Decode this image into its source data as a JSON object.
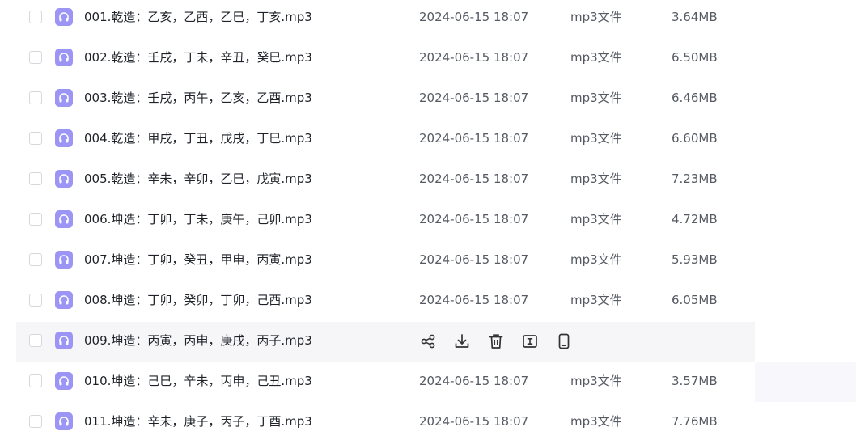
{
  "icons": {
    "file": "audio-headphones-icon",
    "share": "share-icon",
    "download": "download-icon",
    "delete": "trash-icon",
    "rename": "rename-icon",
    "phone": "phone-icon"
  },
  "colors": {
    "file_icon_bg": "#9c95f5",
    "hover_row_bg": "#f6f6f9",
    "meta_text": "#555a63"
  },
  "files": [
    {
      "name": "001.乾造：乙亥，乙酉，乙巳，丁亥.mp3",
      "date": "2024-06-15 18:07",
      "type": "mp3文件",
      "size": "3.64MB"
    },
    {
      "name": "002.乾造：壬戌，丁未，辛丑，癸巳.mp3",
      "date": "2024-06-15 18:07",
      "type": "mp3文件",
      "size": "6.50MB"
    },
    {
      "name": "003.乾造：壬戌，丙午，乙亥，乙酉.mp3",
      "date": "2024-06-15 18:07",
      "type": "mp3文件",
      "size": "6.46MB"
    },
    {
      "name": "004.乾造：甲戌，丁丑，戊戌，丁巳.mp3",
      "date": "2024-06-15 18:07",
      "type": "mp3文件",
      "size": "6.60MB"
    },
    {
      "name": "005.乾造：辛未，辛卯，乙巳，戊寅.mp3",
      "date": "2024-06-15 18:07",
      "type": "mp3文件",
      "size": "7.23MB"
    },
    {
      "name": "006.坤造：丁卯，丁未，庚午，己卯.mp3",
      "date": "2024-06-15 18:07",
      "type": "mp3文件",
      "size": "4.72MB"
    },
    {
      "name": "007.坤造：丁卯，癸丑，甲申，丙寅.mp3",
      "date": "2024-06-15 18:07",
      "type": "mp3文件",
      "size": "5.93MB"
    },
    {
      "name": "008.坤造：丁卯，癸卯，丁卯，己酉.mp3",
      "date": "2024-06-15 18:07",
      "type": "mp3文件",
      "size": "6.05MB"
    },
    {
      "name": "009.坤造：丙寅，丙申，庚戌，丙子.mp3",
      "hovered": true
    },
    {
      "name": "010.坤造：己巳，辛未，丙申，己丑.mp3",
      "date": "2024-06-15 18:07",
      "type": "mp3文件",
      "size": "3.57MB"
    },
    {
      "name": "011.坤造：辛未，庚子，丙子，丁酉.mp3",
      "date": "2024-06-15 18:07",
      "type": "mp3文件",
      "size": "7.76MB"
    }
  ]
}
